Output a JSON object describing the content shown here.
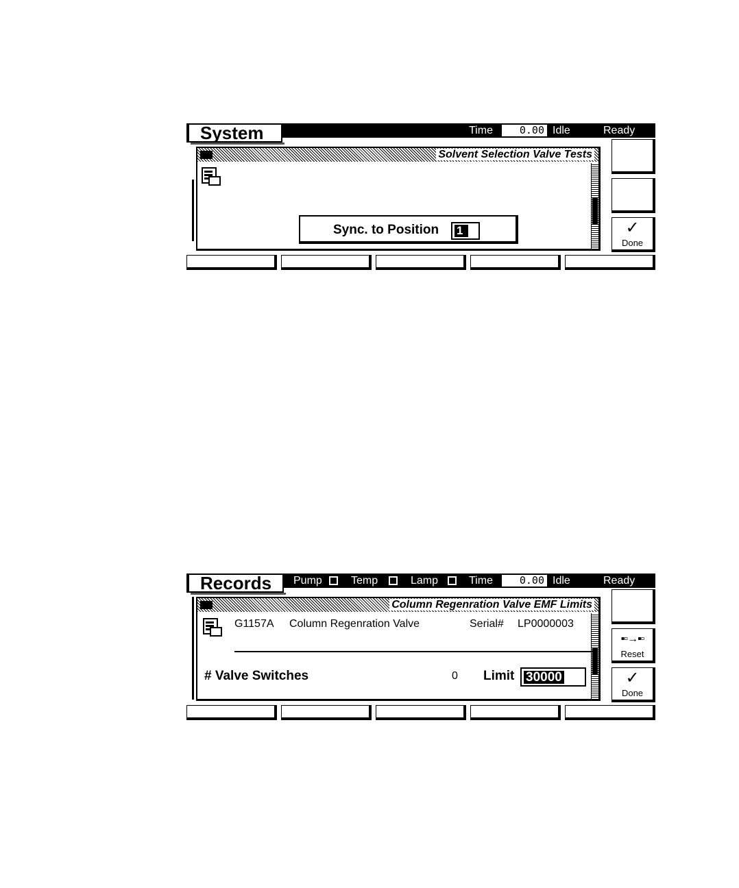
{
  "screen1": {
    "tab_title": "System",
    "time_label": "Time",
    "time_value": "0.00",
    "status_idle": "Idle",
    "status_ready": "Ready",
    "panel_title": "Solvent Selection Valve Tests",
    "sync_label": "Sync. to Position",
    "sync_value": "1",
    "done_label": "Done"
  },
  "screen2": {
    "tab_title": "Records",
    "pump_label": "Pump",
    "temp_label": "Temp",
    "lamp_label": "Lamp",
    "time_label": "Time",
    "time_value": "0.00",
    "status_idle": "Idle",
    "status_ready": "Ready",
    "panel_title": "Column Regenration Valve EMF Limits",
    "device_id": "G1157A",
    "device_name": "Column Regenration Valve",
    "serial_label": "Serial#",
    "serial_value": "LP0000003",
    "switches_label": "# Valve Switches",
    "switches_value": "0",
    "limit_label": "Limit",
    "limit_value": "30000",
    "reset_label": "Reset",
    "done_label": "Done"
  }
}
